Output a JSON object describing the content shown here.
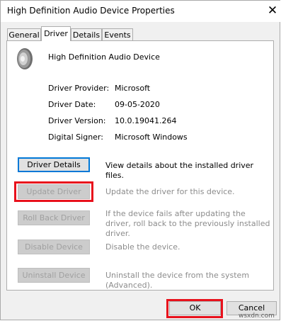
{
  "window": {
    "title": "High Definition Audio Device Properties",
    "close_glyph": "✕"
  },
  "tabs": [
    {
      "label": "General",
      "active": false
    },
    {
      "label": "Driver",
      "active": true
    },
    {
      "label": "Details",
      "active": false
    },
    {
      "label": "Events",
      "active": false
    }
  ],
  "device": {
    "name": "High Definition Audio Device",
    "icon": "speaker-icon"
  },
  "driver_info": [
    {
      "label": "Driver Provider:",
      "value": "Microsoft"
    },
    {
      "label": "Driver Date:",
      "value": "09-05-2020"
    },
    {
      "label": "Driver Version:",
      "value": "10.0.19041.264"
    },
    {
      "label": "Digital Signer:",
      "value": "Microsoft Windows"
    }
  ],
  "actions": [
    {
      "label": "Driver Details",
      "description": "View details about the installed driver files.",
      "enabled": true,
      "highlighted": false
    },
    {
      "label": "Update Driver",
      "description": "Update the driver for this device.",
      "enabled": false,
      "highlighted": true
    },
    {
      "label": "Roll Back Driver",
      "description": "If the device fails after updating the driver, roll back to the previously installed driver.",
      "enabled": false,
      "highlighted": false
    },
    {
      "label": "Disable Device",
      "description": "Disable the device.",
      "enabled": false,
      "highlighted": false
    },
    {
      "label": "Uninstall Device",
      "description": "Uninstall the device from the system (Advanced).",
      "enabled": false,
      "highlighted": false
    }
  ],
  "footer": {
    "ok_label": "OK",
    "cancel_label": "Cancel",
    "ok_highlighted": true
  },
  "watermark": "wsxdn.com",
  "colors": {
    "highlight_red": "#e8111c",
    "focus_blue": "#0078d7",
    "disabled_text": "#a0a0a0"
  }
}
